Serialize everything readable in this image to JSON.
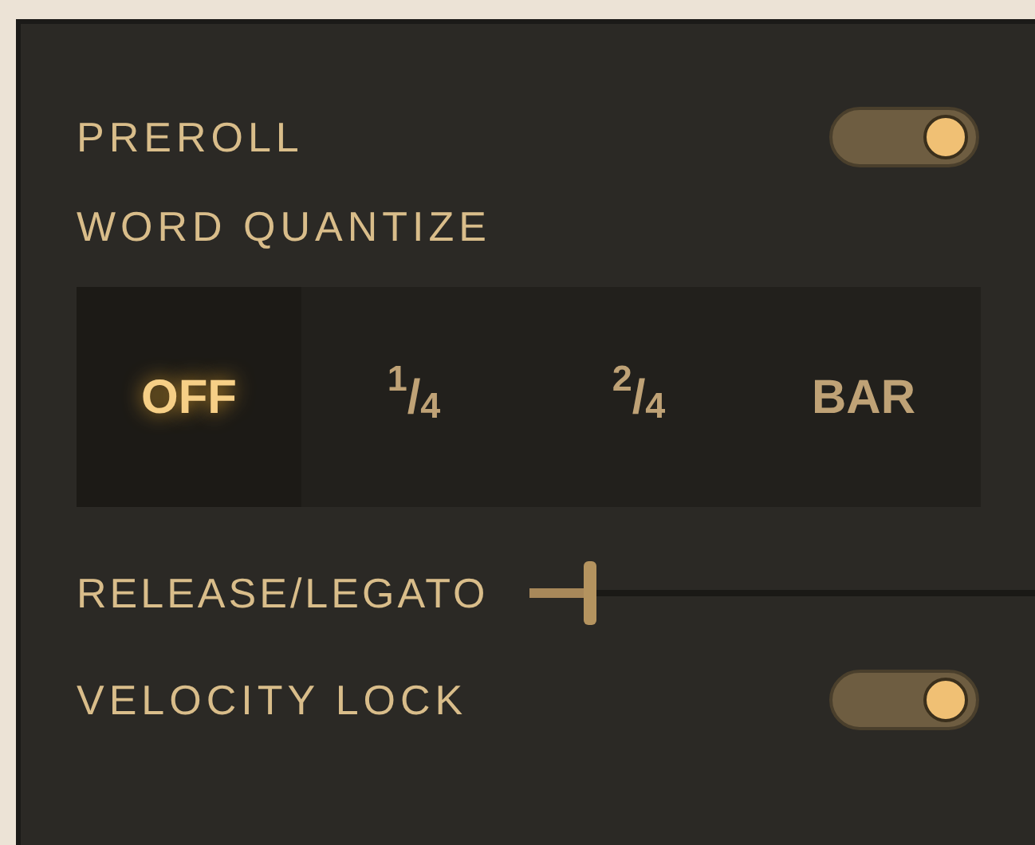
{
  "controls": [
    {
      "kind": "toggle",
      "label": "PREROLL",
      "on": true
    },
    {
      "kind": "segmented",
      "label": "WORD QUANTIZE",
      "options": [
        {
          "label": "OFF",
          "selected": true
        },
        {
          "label": "$^{1}$/$_{4}$",
          "selected": false
        },
        {
          "label": "$^{2}$/$_{4}$",
          "selected": false
        },
        {
          "label": "BAR",
          "selected": false
        }
      ]
    },
    {
      "kind": "slider",
      "label": "RELEASE/LEGATO",
      "level": 0.12
    },
    {
      "kind": "toggle",
      "label": "VELOCITY LOCK",
      "on": true
    }
  ]
}
